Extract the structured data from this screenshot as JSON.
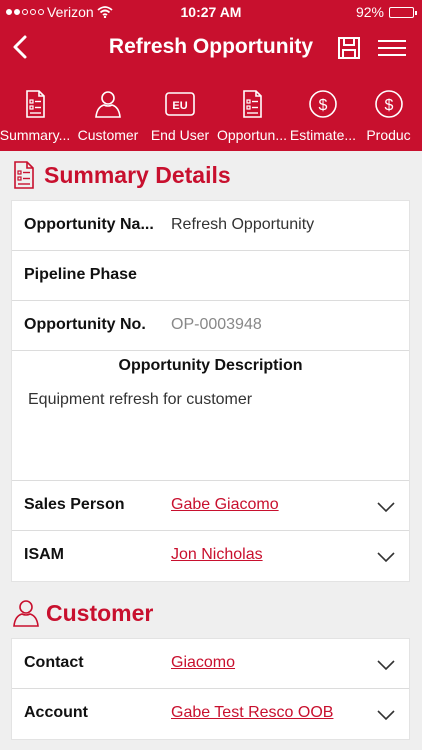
{
  "status_bar": {
    "carrier": "Verizon",
    "time": "10:27 AM",
    "battery": "92%",
    "battery_level": 0.92
  },
  "nav": {
    "title": "Refresh Opportunity"
  },
  "tabs": [
    {
      "label": "Summary...",
      "icon": "document-list-icon"
    },
    {
      "label": "Customer",
      "icon": "person-icon"
    },
    {
      "label": "End User",
      "icon": "eu-badge-icon",
      "badge": "EU"
    },
    {
      "label": "Opportun...",
      "icon": "document-list-icon"
    },
    {
      "label": "Estimate...",
      "icon": "dollar-circle-icon"
    },
    {
      "label": "Produc",
      "icon": "dollar-circle-icon"
    }
  ],
  "summary": {
    "title": "Summary Details",
    "opportunity_name_label": "Opportunity Na...",
    "opportunity_name_value": "Refresh Opportunity",
    "pipeline_phase_label": "Pipeline Phase",
    "opportunity_no_label": "Opportunity No.",
    "opportunity_no_value": "OP-0003948",
    "description_label": "Opportunity Description",
    "description_value": "Equipment refresh for customer",
    "sales_person_label": "Sales Person",
    "sales_person_value": "Gabe Giacomo",
    "isam_label": "ISAM",
    "isam_value": "Jon Nicholas"
  },
  "customer": {
    "title": "Customer",
    "contact_label": "Contact",
    "contact_value": "Giacomo",
    "account_label": "Account",
    "account_value": "Gabe Test Resco OOB"
  },
  "colors": {
    "brand": "#c8102e",
    "background": "#efefef"
  }
}
